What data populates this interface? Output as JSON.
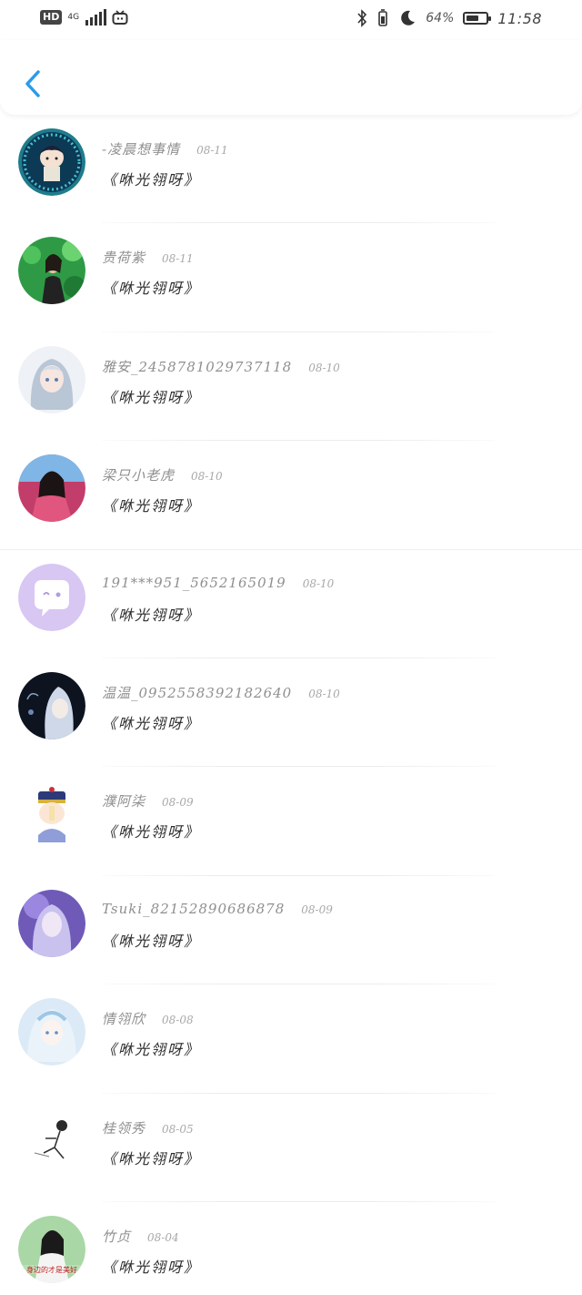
{
  "status_bar": {
    "hd": "HD",
    "network": "4G",
    "battery_percent": "64%",
    "battery_level": 0.64,
    "time": "11:58"
  },
  "colors": {
    "accent": "#2a9bea",
    "name_text": "#8f8f8f",
    "date_text": "#a8a8a8",
    "message_text": "#2a2a2a"
  },
  "messages": [
    {
      "name": "-凌晨想事情",
      "date": "08-11",
      "text": "《咻光翎呀》",
      "avatar": "anime-boy-avatar"
    },
    {
      "name": "贵荷紫",
      "date": "08-11",
      "text": "《咻光翎呀》",
      "avatar": "girl-greenery-avatar"
    },
    {
      "name": "雅安_2458781029737118",
      "date": "08-10",
      "text": "《咻光翎呀》",
      "avatar": "anime-girl-silver-avatar"
    },
    {
      "name": "梁只小老虎",
      "date": "08-10",
      "text": "《咻光翎呀》",
      "avatar": "girl-pink-avatar"
    },
    {
      "name": "191***951_5652165019",
      "date": "08-10",
      "text": "《咻光翎呀》",
      "avatar": "default-chat-avatar"
    },
    {
      "name": "温温_0952558392182640",
      "date": "08-10",
      "text": "《咻光翎呀》",
      "avatar": "anime-dark-avatar"
    },
    {
      "name": "濮阿柒",
      "date": "08-09",
      "text": "《咻光翎呀》",
      "avatar": "qing-cartoon-avatar"
    },
    {
      "name": "Tsuki_82152890686878",
      "date": "08-09",
      "text": "《咻光翎呀》",
      "avatar": "anime-purple-avatar"
    },
    {
      "name": "情翎欣",
      "date": "08-08",
      "text": "《咻光翎呀》",
      "avatar": "anime-ice-avatar"
    },
    {
      "name": "桂领秀",
      "date": "08-05",
      "text": "《咻光翎呀》",
      "avatar": "sketch-figure-avatar"
    },
    {
      "name": "竹贞",
      "date": "08-04",
      "text": "《咻光翎呀》",
      "avatar": "girl-poster-avatar"
    }
  ],
  "avatar_caption": "身边的才是美好"
}
